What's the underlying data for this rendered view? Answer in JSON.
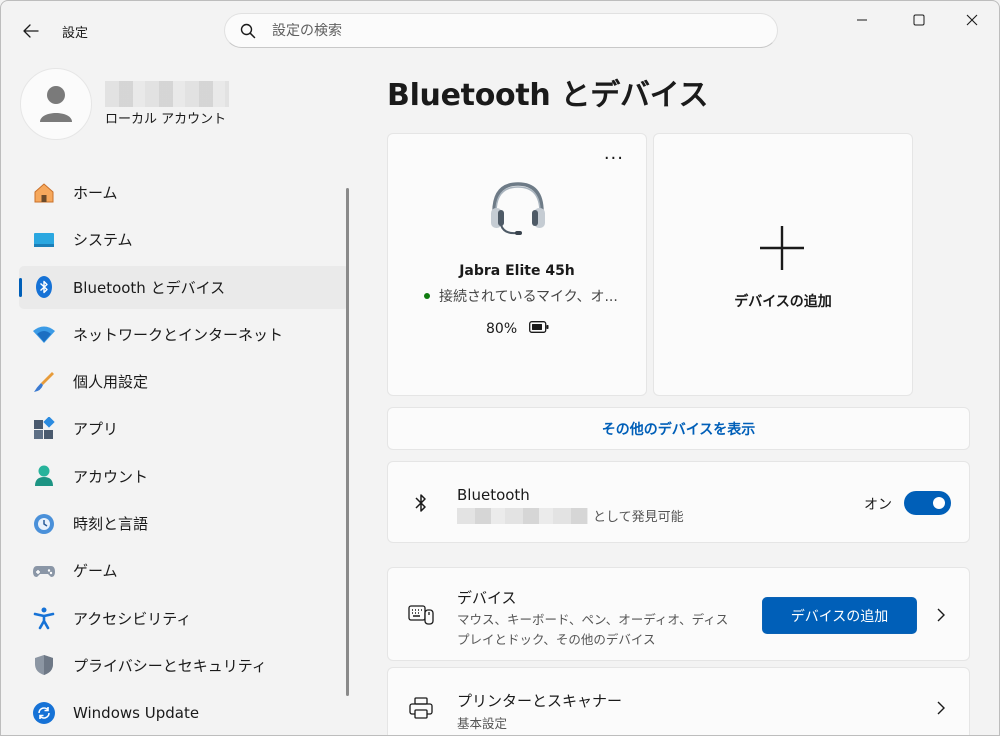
{
  "window": {
    "app_title": "設定",
    "search_placeholder": "設定の検索"
  },
  "profile": {
    "account_type": "ローカル アカウント"
  },
  "sidebar": {
    "items": [
      {
        "label": "ホーム",
        "icon": "home-icon",
        "active": false
      },
      {
        "label": "システム",
        "icon": "system-icon",
        "active": false
      },
      {
        "label": "Bluetooth とデバイス",
        "icon": "bluetooth-icon",
        "active": true
      },
      {
        "label": "ネットワークとインターネット",
        "icon": "wifi-icon",
        "active": false
      },
      {
        "label": "個人用設定",
        "icon": "brush-icon",
        "active": false
      },
      {
        "label": "アプリ",
        "icon": "apps-icon",
        "active": false
      },
      {
        "label": "アカウント",
        "icon": "account-icon",
        "active": false
      },
      {
        "label": "時刻と言語",
        "icon": "time-language-icon",
        "active": false
      },
      {
        "label": "ゲーム",
        "icon": "gamepad-icon",
        "active": false
      },
      {
        "label": "アクセシビリティ",
        "icon": "accessibility-icon",
        "active": false
      },
      {
        "label": "プライバシーとセキュリティ",
        "icon": "shield-icon",
        "active": false
      },
      {
        "label": "Windows Update",
        "icon": "update-icon",
        "active": false
      }
    ]
  },
  "main": {
    "title": "Bluetooth とデバイス",
    "device_card": {
      "name": "Jabra Elite 45h",
      "status": "接続されているマイク、オ...",
      "battery": "80%"
    },
    "add_card": {
      "label": "デバイスの追加"
    },
    "show_more": "その他のデバイスを表示",
    "bluetooth_row": {
      "title": "Bluetooth",
      "subtitle": "として発見可能",
      "toggle_label": "オン",
      "toggle_on": true
    },
    "devices_row": {
      "title": "デバイス",
      "subtitle": "マウス、キーボード、ペン、オーディオ、ディスプレイとドック、その他のデバイス",
      "button": "デバイスの追加"
    },
    "printers_row": {
      "title": "プリンターとスキャナー",
      "subtitle": "基本設定"
    }
  },
  "colors": {
    "accent": "#005fb8",
    "background": "#f3f3f3",
    "card": "#fbfbfb",
    "status_connected": "#0f7b0f"
  }
}
